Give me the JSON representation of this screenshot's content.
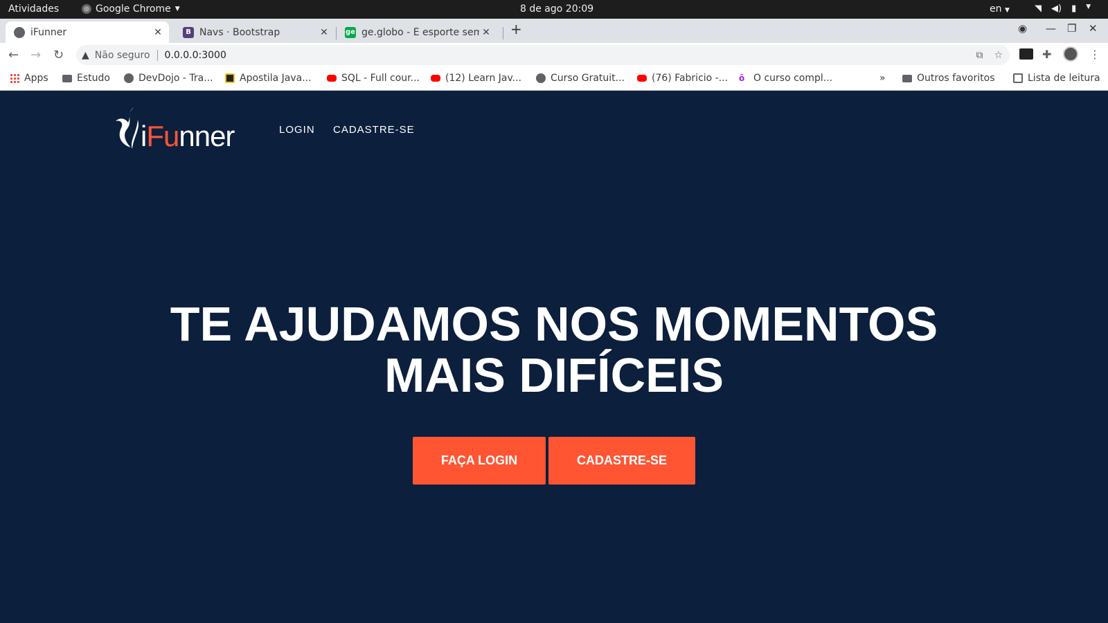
{
  "os": {
    "activities": "Atividades",
    "app_name": "Google Chrome",
    "clock": "8 de ago  20:09",
    "lang": "en"
  },
  "tabs": [
    {
      "title": "iFunner",
      "favicon": "globe-icon",
      "active": true
    },
    {
      "title": "Navs · Bootstrap",
      "favicon": "bootstrap-icon",
      "favicon_letter": "B",
      "active": false
    },
    {
      "title": "ge.globo - É esporte semp",
      "favicon": "ge-icon",
      "favicon_letter": "ge",
      "active": false
    }
  ],
  "toolbar": {
    "security": "Não seguro",
    "url": "0.0.0.0:3000"
  },
  "bookmarks": [
    {
      "label": "Apps",
      "icon": "apps-icon"
    },
    {
      "label": "Estudo",
      "icon": "folder-icon"
    },
    {
      "label": "DevDojo - Tra...",
      "icon": "globe-icon"
    },
    {
      "label": "Apostila Java...",
      "icon": "book-icon"
    },
    {
      "label": "SQL - Full cour...",
      "icon": "youtube-icon"
    },
    {
      "label": "(12) Learn Jav...",
      "icon": "youtube-icon"
    },
    {
      "label": "Curso Gratuit...",
      "icon": "globe-icon"
    },
    {
      "label": "(76) Fabricio -...",
      "icon": "youtube-icon"
    },
    {
      "label": "O curso compl...",
      "icon": "o-icon"
    }
  ],
  "bookmarks_right": {
    "more": "»",
    "other": "Outros favoritos",
    "reading_list": "Lista de leitura"
  },
  "site": {
    "brand_prefix": "i",
    "brand_highlight": "Fu",
    "brand_suffix": "nner",
    "nav": [
      "LOGIN",
      "CADASTRE-SE"
    ],
    "hero_line1": "TE AJUDAMOS NOS MOMENTOS",
    "hero_line2": "MAIS DIFÍCEIS",
    "cta_login": "FAÇA LOGIN",
    "cta_signup": "CADASTRE-SE",
    "colors": {
      "background": "#0c1f3c",
      "accent": "#ff5533",
      "text": "#ffffff"
    }
  }
}
